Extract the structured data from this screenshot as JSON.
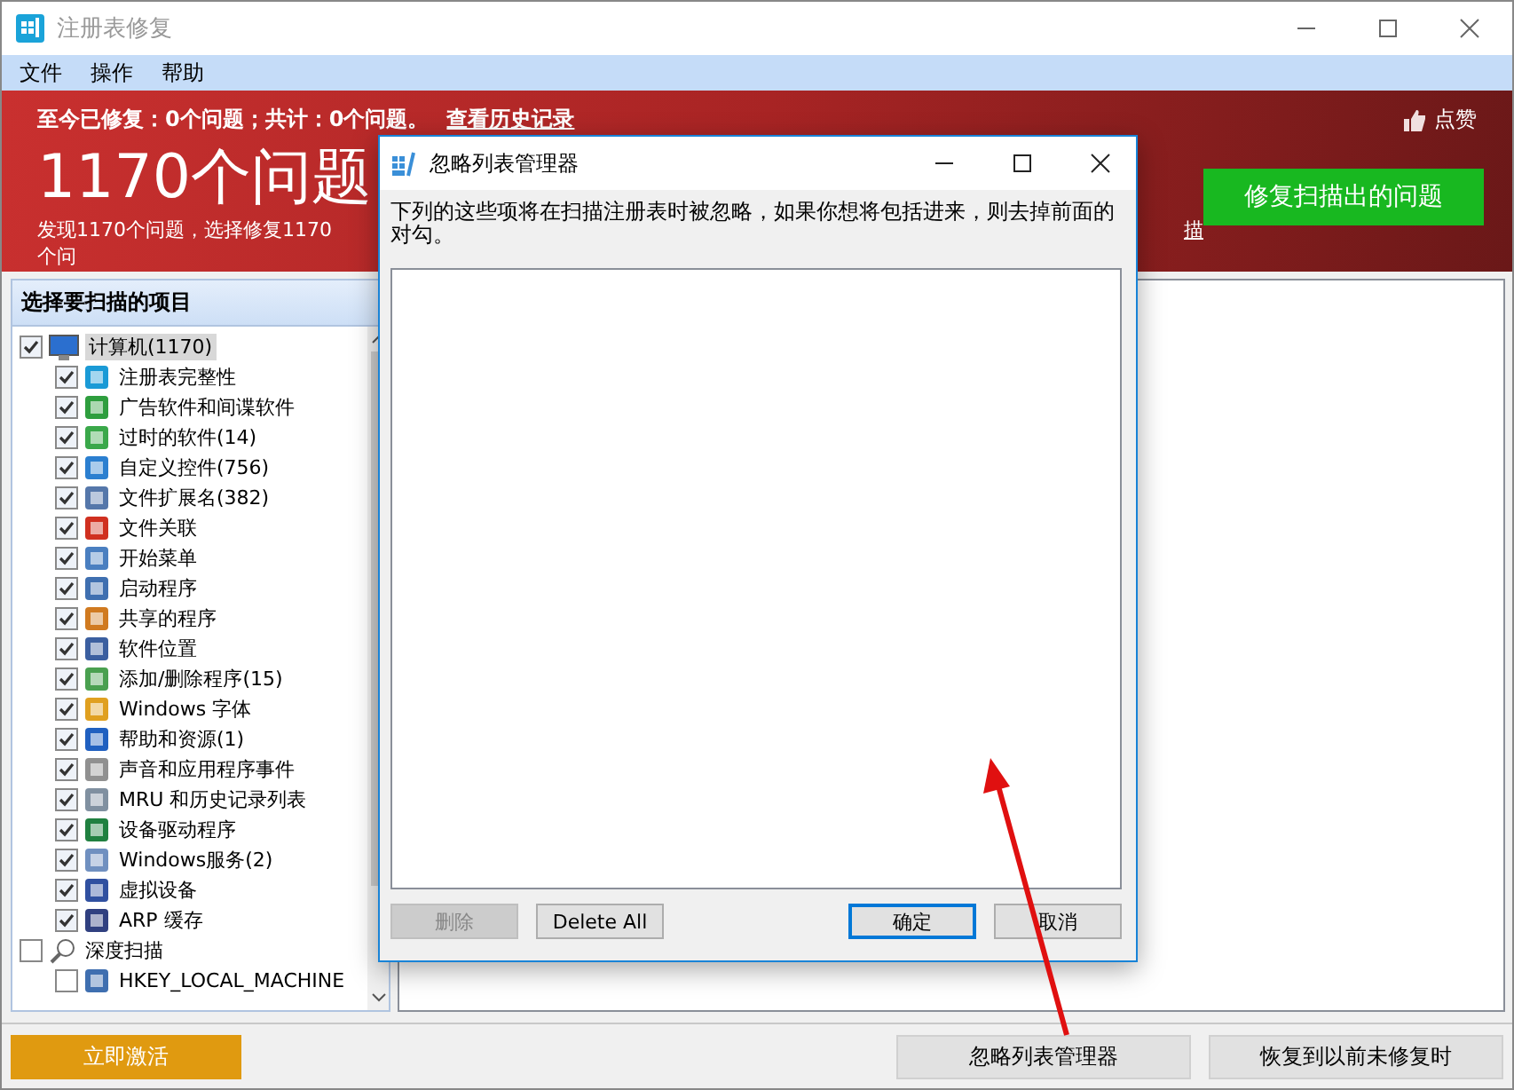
{
  "window": {
    "title": "注册表修复"
  },
  "menu": [
    {
      "label": "文件"
    },
    {
      "label": "操作"
    },
    {
      "label": "帮助"
    }
  ],
  "banner": {
    "summary": "至今已修复：0个问题；共计：0个问题。",
    "history_link": "查看历史记录",
    "count": "1170个问题",
    "detail": "发现1170个问题，选择修复1170个问",
    "detail_link": "描",
    "like": "点赞",
    "fix_button": "修复扫描出的问题"
  },
  "scan_panel": {
    "title": "选择要扫描的项目",
    "tree": [
      {
        "label": "计算机(1170)",
        "checked": true,
        "selected": true,
        "children": [
          {
            "label": "注册表完整性",
            "checked": true,
            "selected": false
          },
          {
            "label": "广告软件和间谍软件",
            "checked": true,
            "selected": false
          },
          {
            "label": "过时的软件(14)",
            "checked": true,
            "selected": false
          },
          {
            "label": "自定义控件(756)",
            "checked": true,
            "selected": false
          },
          {
            "label": "文件扩展名(382)",
            "checked": true,
            "selected": false
          },
          {
            "label": "文件关联",
            "checked": true,
            "selected": false
          },
          {
            "label": "开始菜单",
            "checked": true,
            "selected": false
          },
          {
            "label": "启动程序",
            "checked": true,
            "selected": false
          },
          {
            "label": "共享的程序",
            "checked": true,
            "selected": false
          },
          {
            "label": "软件位置",
            "checked": true,
            "selected": false
          },
          {
            "label": "添加/删除程序(15)",
            "checked": true,
            "selected": false
          },
          {
            "label": "Windows 字体",
            "checked": true,
            "selected": false
          },
          {
            "label": "帮助和资源(1)",
            "checked": true,
            "selected": false
          },
          {
            "label": "声音和应用程序事件",
            "checked": true,
            "selected": false
          },
          {
            "label": "MRU 和历史记录列表",
            "checked": true,
            "selected": false
          },
          {
            "label": "设备驱动程序",
            "checked": true,
            "selected": false
          },
          {
            "label": "Windows服务(2)",
            "checked": true,
            "selected": false
          },
          {
            "label": "虚拟设备",
            "checked": true,
            "selected": false
          },
          {
            "label": "ARP 缓存",
            "checked": true,
            "selected": false
          }
        ]
      },
      {
        "label": "深度扫描",
        "checked": false,
        "selected": false,
        "children": [
          {
            "label": "HKEY_LOCAL_MACHINE",
            "checked": false,
            "selected": false
          }
        ]
      }
    ]
  },
  "bottom": {
    "activate_button": "立即激活",
    "buttons": [
      "忽略列表管理器",
      "恢复到以前未修复时"
    ]
  },
  "dialog": {
    "title": "忽略列表管理器",
    "message": "下列的这些项将在扫描注册表时被忽略，如果你想将包括进来，则去掉前面的对勾。",
    "buttons": [
      {
        "label": "删除",
        "disabled": true,
        "default": false
      },
      {
        "label": "Delete All",
        "disabled": false,
        "default": false
      },
      {
        "label": "确定",
        "disabled": false,
        "default": true
      },
      {
        "label": "取消",
        "disabled": false,
        "default": false
      }
    ]
  }
}
